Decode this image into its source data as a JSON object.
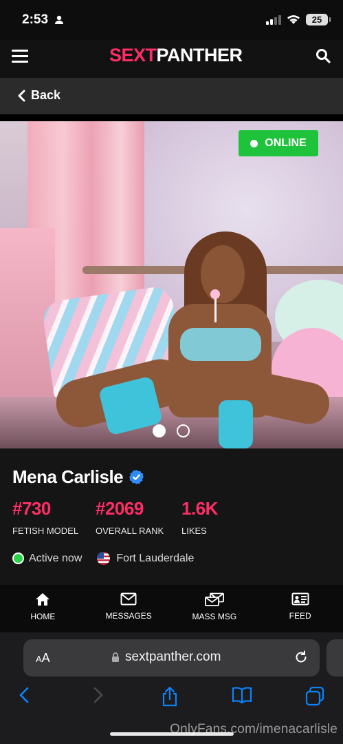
{
  "status_bar": {
    "time": "2:53",
    "battery": "25"
  },
  "header": {
    "logo_part1": "SEXT",
    "logo_part2": "PANTHER"
  },
  "nav": {
    "back_label": "Back"
  },
  "photo": {
    "online_label": "ONLINE",
    "pager_count": 2,
    "pager_active": 1
  },
  "profile": {
    "name": "Mena Carlisle",
    "stats": [
      {
        "value": "#730",
        "label": "FETISH MODEL"
      },
      {
        "value": "#2069",
        "label": "OVERALL RANK"
      },
      {
        "value": "1.6K",
        "label": "LIKES"
      }
    ],
    "active_status": "Active now",
    "location": "Fort Lauderdale"
  },
  "bottom_nav": [
    {
      "label": "HOME",
      "icon": "home-icon"
    },
    {
      "label": "MESSAGES",
      "icon": "envelope-icon"
    },
    {
      "label": "MASS MSG",
      "icon": "mass-message-icon"
    },
    {
      "label": "FEED",
      "icon": "feed-icon"
    }
  ],
  "browser": {
    "text_size_label": "AA",
    "url": "sextpanther.com"
  },
  "watermark": "OnlyFans.com/imenacarlisle",
  "colors": {
    "brand_pink": "#ff2d66",
    "online_green": "#1fc33b",
    "ios_blue": "#0a84ff"
  }
}
